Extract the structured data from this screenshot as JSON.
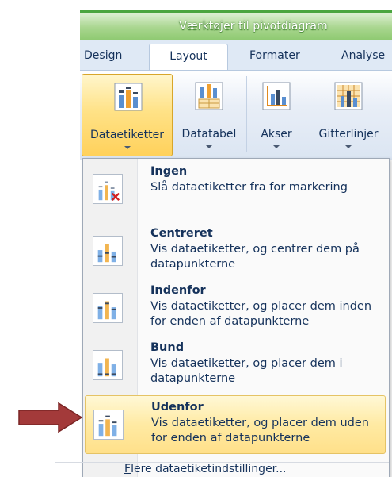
{
  "ribbon": {
    "context_title": "Værktøjer til pivotdiagram",
    "tabs": [
      {
        "label": "Design"
      },
      {
        "label": "Layout"
      },
      {
        "label": "Formater"
      },
      {
        "label": "Analyse"
      }
    ],
    "active_tab": "Layout",
    "buttons": [
      {
        "label": "Dataetiketter",
        "icon": "data-labels-icon",
        "selected": true
      },
      {
        "label": "Datatabel",
        "icon": "data-table-icon",
        "selected": false
      },
      {
        "label": "Akser",
        "icon": "axes-icon",
        "selected": false
      },
      {
        "label": "Gitterlinjer",
        "icon": "gridlines-icon",
        "selected": false
      }
    ]
  },
  "dropdown": {
    "items": [
      {
        "title": "Ingen",
        "description": "Slå dataetiketter fra for markering",
        "icon": "labels-none-icon",
        "highlighted": false
      },
      {
        "title": "Centreret",
        "description": "Vis dataetiketter, og centrer dem på datapunkterne",
        "icon": "labels-center-icon",
        "highlighted": false
      },
      {
        "title": "Indenfor",
        "description": "Vis dataetiketter, og placer dem inden for enden af datapunkterne",
        "icon": "labels-inside-end-icon",
        "highlighted": false
      },
      {
        "title": "Bund",
        "description": "Vis dataetiketter, og placer dem i datapunkterne",
        "icon": "labels-base-icon",
        "highlighted": false
      },
      {
        "title": "Udenfor",
        "description": "Vis dataetiketter, og placer dem uden for enden af datapunkterne",
        "icon": "labels-outside-end-icon",
        "highlighted": true
      }
    ],
    "more_options": {
      "mnemonic": "F",
      "rest": "lere dataetiketindstillinger..."
    }
  },
  "colors": {
    "context_green": "#8fca72",
    "text_navy": "#15325b",
    "highlight": "#ffe08a",
    "arrow": "#a33a3a"
  }
}
